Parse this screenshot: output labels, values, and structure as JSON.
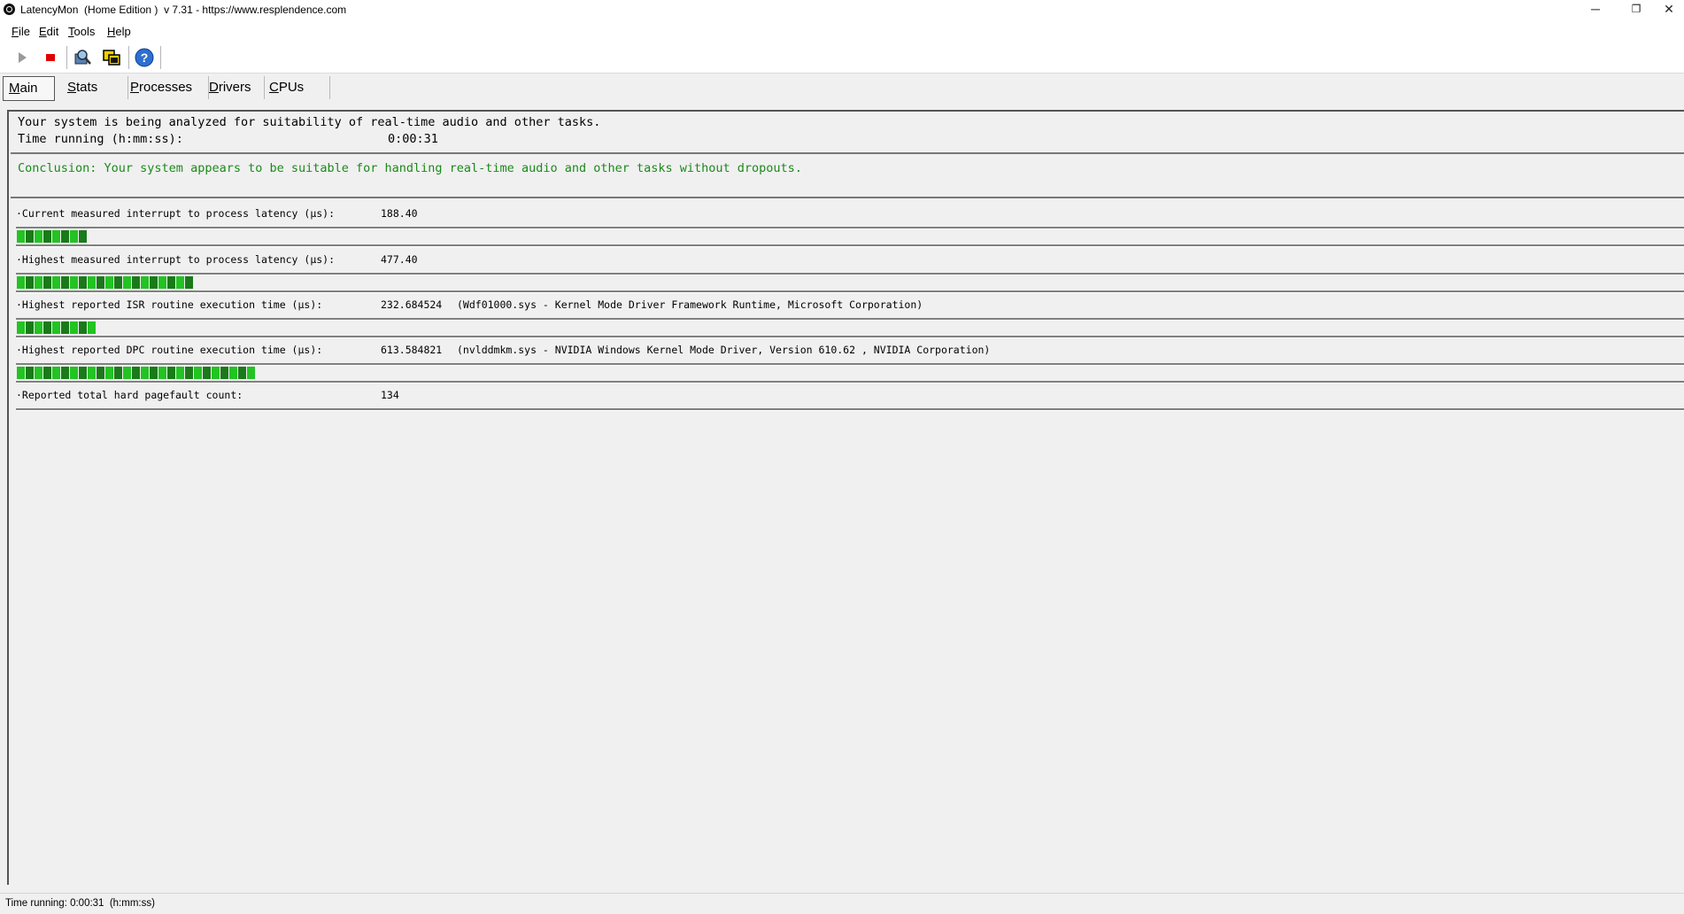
{
  "window": {
    "title": "LatencyMon  (Home Edition )  v 7.31 - https://www.resplendence.com",
    "minimize_glyph": "─",
    "restore_glyph": "❐",
    "close_glyph": "✕"
  },
  "menu": [
    {
      "first": "F",
      "rest": "ile"
    },
    {
      "first": "E",
      "rest": "dit"
    },
    {
      "first": "T",
      "rest": "ools"
    },
    {
      "first": "H",
      "rest": "elp"
    }
  ],
  "toolbar": {
    "icons": [
      "play-icon",
      "stop-icon",
      "drivers-icon",
      "windows-icon",
      "help-icon"
    ]
  },
  "tabs": [
    {
      "first": "M",
      "rest": "ain",
      "active": true
    },
    {
      "first": "S",
      "rest": "tats",
      "active": false
    },
    {
      "first": "P",
      "rest": "rocesses",
      "active": false
    },
    {
      "first": "D",
      "rest": "rivers",
      "active": false
    },
    {
      "first": "C",
      "rest": "PUs",
      "active": false
    }
  ],
  "analysis": {
    "line1": "Your system is being analyzed for suitability of real-time audio and other tasks.",
    "time_label": "Time running (h:mm:ss):",
    "time_value": "0:00:31"
  },
  "conclusion": "Conclusion: Your system appears to be suitable for handling real-time audio and other tasks without dropouts.",
  "metrics": [
    {
      "label": "·Current measured interrupt to process latency (µs):",
      "value": "188.40",
      "detail": "",
      "bar_segments": 8
    },
    {
      "label": "·Highest measured interrupt to process latency (µs):",
      "value": "477.40",
      "detail": "",
      "bar_segments": 20
    },
    {
      "label": "·Highest reported ISR routine execution time (µs):",
      "value": "232.684524",
      "detail": "(Wdf01000.sys - Kernel Mode Driver Framework Runtime, Microsoft Corporation)",
      "bar_segments": 9
    },
    {
      "label": "·Highest reported DPC routine execution time (µs):",
      "value": "613.584821",
      "detail": "(nvlddmkm.sys - NVIDIA Windows Kernel Mode Driver, Version 610.62 , NVIDIA Corporation)",
      "bar_segments": 27
    },
    {
      "label": "·Reported total hard pagefault count:",
      "value": "134",
      "detail": "",
      "bar_segments": 0
    }
  ],
  "colors": {
    "conclusion_green": "#1a8a1a",
    "bar_green": "#22c322",
    "bar_dark_green": "#1a7a1a"
  },
  "statusbar": {
    "text": "Time running: 0:00:31  (h:mm:ss)"
  }
}
